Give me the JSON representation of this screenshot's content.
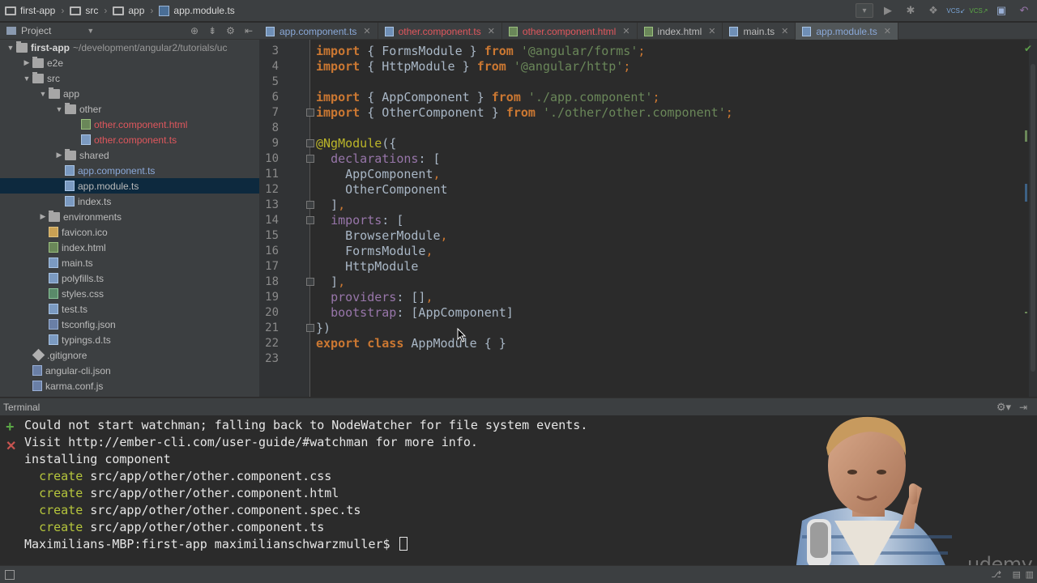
{
  "breadcrumb": [
    "first-app",
    "src",
    "app",
    "app.module.ts"
  ],
  "project_panel": {
    "title": "Project",
    "tree": [
      {
        "label": "first-app",
        "path": "~/development/angular2/tutorials/uc",
        "depth": 0,
        "arrow": "down",
        "icon": "folder",
        "style": "root"
      },
      {
        "label": "e2e",
        "depth": 1,
        "arrow": "right",
        "icon": "folder",
        "style": "normal"
      },
      {
        "label": "src",
        "depth": 1,
        "arrow": "down",
        "icon": "folder",
        "style": "normal"
      },
      {
        "label": "app",
        "depth": 2,
        "arrow": "down",
        "icon": "folder",
        "style": "normal"
      },
      {
        "label": "other",
        "depth": 3,
        "arrow": "down",
        "icon": "folder",
        "style": "normal"
      },
      {
        "label": "other.component.html",
        "depth": 4,
        "arrow": "",
        "icon": "html",
        "style": "red"
      },
      {
        "label": "other.component.ts",
        "depth": 4,
        "arrow": "",
        "icon": "ts",
        "style": "red"
      },
      {
        "label": "shared",
        "depth": 3,
        "arrow": "right",
        "icon": "folder",
        "style": "normal"
      },
      {
        "label": "app.component.ts",
        "depth": 3,
        "arrow": "",
        "icon": "ts",
        "style": "blue"
      },
      {
        "label": "app.module.ts",
        "depth": 3,
        "arrow": "",
        "icon": "ts",
        "style": "selected"
      },
      {
        "label": "index.ts",
        "depth": 3,
        "arrow": "",
        "icon": "ts",
        "style": "normal"
      },
      {
        "label": "environments",
        "depth": 2,
        "arrow": "right",
        "icon": "folder",
        "style": "normal"
      },
      {
        "label": "favicon.ico",
        "depth": 2,
        "arrow": "",
        "icon": "ico",
        "style": "normal"
      },
      {
        "label": "index.html",
        "depth": 2,
        "arrow": "",
        "icon": "html",
        "style": "normal"
      },
      {
        "label": "main.ts",
        "depth": 2,
        "arrow": "",
        "icon": "ts",
        "style": "normal"
      },
      {
        "label": "polyfills.ts",
        "depth": 2,
        "arrow": "",
        "icon": "ts",
        "style": "normal"
      },
      {
        "label": "styles.css",
        "depth": 2,
        "arrow": "",
        "icon": "css",
        "style": "normal"
      },
      {
        "label": "test.ts",
        "depth": 2,
        "arrow": "",
        "icon": "ts",
        "style": "normal"
      },
      {
        "label": "tsconfig.json",
        "depth": 2,
        "arrow": "",
        "icon": "json",
        "style": "normal"
      },
      {
        "label": "typings.d.ts",
        "depth": 2,
        "arrow": "",
        "icon": "ts",
        "style": "normal"
      },
      {
        "label": ".gitignore",
        "depth": 1,
        "arrow": "",
        "icon": "git",
        "style": "normal"
      },
      {
        "label": "angular-cli.json",
        "depth": 1,
        "arrow": "",
        "icon": "json",
        "style": "normal"
      },
      {
        "label": "karma.conf.js",
        "depth": 1,
        "arrow": "",
        "icon": "json",
        "style": "normal"
      }
    ]
  },
  "tabs": [
    {
      "label": "app.component.ts",
      "icon": "ts",
      "style": "blue",
      "active": false
    },
    {
      "label": "other.component.ts",
      "icon": "ts",
      "style": "red",
      "active": false
    },
    {
      "label": "other.component.html",
      "icon": "html",
      "style": "red",
      "active": false
    },
    {
      "label": "index.html",
      "icon": "html",
      "style": "normal",
      "active": false
    },
    {
      "label": "main.ts",
      "icon": "ts",
      "style": "normal",
      "active": false
    },
    {
      "label": "app.module.ts",
      "icon": "ts",
      "style": "blue",
      "active": true
    }
  ],
  "editor": {
    "lines": [
      {
        "n": "3",
        "tokens": [
          [
            "kw",
            "import"
          ],
          [
            "p",
            " { FormsModule } "
          ],
          [
            "kw",
            "from"
          ],
          [
            "p",
            " "
          ],
          [
            "str",
            "'@angular/forms'"
          ],
          [
            "punct",
            ";"
          ]
        ]
      },
      {
        "n": "4",
        "tokens": [
          [
            "kw",
            "import"
          ],
          [
            "p",
            " { HttpModule } "
          ],
          [
            "kw",
            "from"
          ],
          [
            "p",
            " "
          ],
          [
            "str",
            "'@angular/http'"
          ],
          [
            "punct",
            ";"
          ]
        ]
      },
      {
        "n": "5",
        "tokens": []
      },
      {
        "n": "6",
        "tokens": [
          [
            "kw",
            "import"
          ],
          [
            "p",
            " { AppComponent } "
          ],
          [
            "kw",
            "from"
          ],
          [
            "p",
            " "
          ],
          [
            "str",
            "'./app.component'"
          ],
          [
            "punct",
            ";"
          ]
        ]
      },
      {
        "n": "7",
        "tokens": [
          [
            "kw",
            "import"
          ],
          [
            "p",
            " { OtherComponent } "
          ],
          [
            "kw",
            "from"
          ],
          [
            "p",
            " "
          ],
          [
            "str",
            "'./other/other.component'"
          ],
          [
            "punct",
            ";"
          ]
        ]
      },
      {
        "n": "8",
        "tokens": []
      },
      {
        "n": "9",
        "tokens": [
          [
            "dec",
            "@NgModule"
          ],
          [
            "p",
            "({"
          ]
        ]
      },
      {
        "n": "10",
        "tokens": [
          [
            "p",
            "  "
          ],
          [
            "prop",
            "declarations"
          ],
          [
            "p",
            ": ["
          ]
        ]
      },
      {
        "n": "11",
        "tokens": [
          [
            "p",
            "    AppComponent"
          ],
          [
            "punct",
            ","
          ]
        ]
      },
      {
        "n": "12",
        "tokens": [
          [
            "p",
            "    OtherComponent"
          ]
        ]
      },
      {
        "n": "13",
        "tokens": [
          [
            "p",
            "  ]"
          ],
          [
            "punct",
            ","
          ]
        ]
      },
      {
        "n": "14",
        "tokens": [
          [
            "p",
            "  "
          ],
          [
            "prop",
            "imports"
          ],
          [
            "p",
            ": ["
          ]
        ]
      },
      {
        "n": "15",
        "tokens": [
          [
            "p",
            "    BrowserModule"
          ],
          [
            "punct",
            ","
          ]
        ]
      },
      {
        "n": "16",
        "tokens": [
          [
            "p",
            "    FormsModule"
          ],
          [
            "punct",
            ","
          ]
        ]
      },
      {
        "n": "17",
        "tokens": [
          [
            "p",
            "    HttpModule"
          ]
        ]
      },
      {
        "n": "18",
        "tokens": [
          [
            "p",
            "  ]"
          ],
          [
            "punct",
            ","
          ]
        ]
      },
      {
        "n": "19",
        "tokens": [
          [
            "p",
            "  "
          ],
          [
            "prop",
            "providers"
          ],
          [
            "p",
            ": []"
          ],
          [
            "punct",
            ","
          ]
        ]
      },
      {
        "n": "20",
        "tokens": [
          [
            "p",
            "  "
          ],
          [
            "prop",
            "bootstrap"
          ],
          [
            "p",
            ": [AppComponent]"
          ]
        ]
      },
      {
        "n": "21",
        "tokens": [
          [
            "p",
            "})"
          ]
        ]
      },
      {
        "n": "22",
        "tokens": [
          [
            "kw",
            "export"
          ],
          [
            "p",
            " "
          ],
          [
            "kw",
            "class"
          ],
          [
            "p",
            " AppModule { }"
          ]
        ]
      },
      {
        "n": "23",
        "tokens": []
      }
    ]
  },
  "terminal": {
    "title": "Terminal",
    "lines": [
      [
        [
          "t",
          "Could not start watchman; falling back to NodeWatcher for file system events."
        ]
      ],
      [
        [
          "t",
          "Visit http://ember-cli.com/user-guide/#watchman for more info."
        ]
      ],
      [
        [
          "t",
          "installing component"
        ]
      ],
      [
        [
          "t",
          "  "
        ],
        [
          "g",
          "create"
        ],
        [
          "t",
          " src/app/other/other.component.css"
        ]
      ],
      [
        [
          "t",
          "  "
        ],
        [
          "g",
          "create"
        ],
        [
          "t",
          " src/app/other/other.component.html"
        ]
      ],
      [
        [
          "t",
          "  "
        ],
        [
          "g",
          "create"
        ],
        [
          "t",
          " src/app/other/other.component.spec.ts"
        ]
      ],
      [
        [
          "t",
          "  "
        ],
        [
          "g",
          "create"
        ],
        [
          "t",
          " src/app/other/other.component.ts"
        ]
      ],
      [
        [
          "t",
          "Maximilians-MBP:first-app maximilianschwarzmuller$ "
        ]
      ]
    ]
  },
  "watermark": "udemy",
  "colors": {
    "keyword": "#cc7832",
    "string": "#6a8759",
    "property": "#9876aa",
    "decorator": "#bbb529",
    "terminal_create": "#b5c53c",
    "modified_file": "#e0575d",
    "new_file": "#8aa8d8"
  }
}
